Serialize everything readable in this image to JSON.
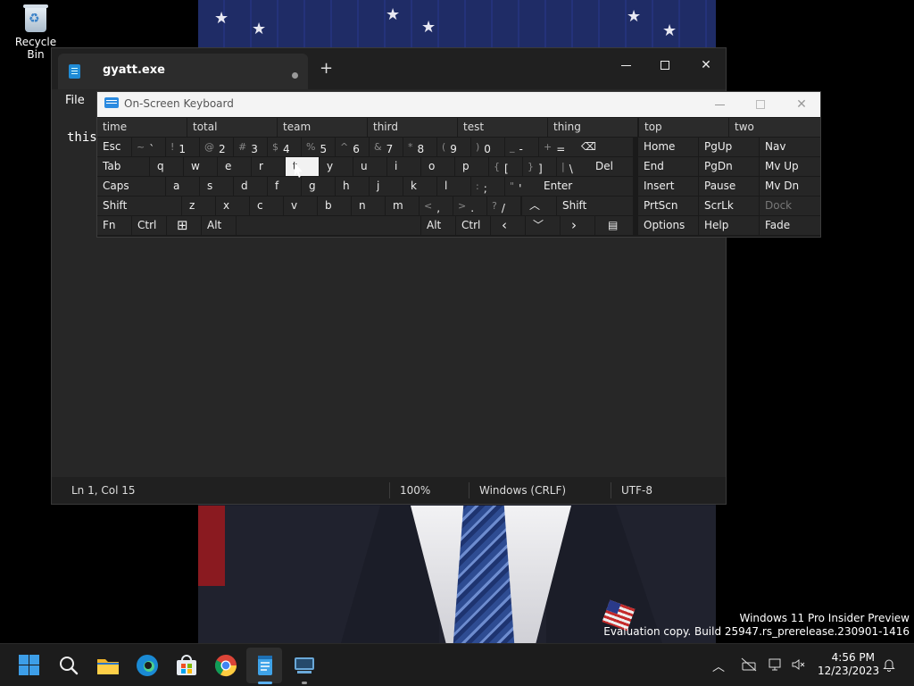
{
  "desktop": {
    "recycle_bin_label": "Recycle Bin",
    "watermark_line1": "Windows 11 Pro Insider Preview",
    "watermark_line2": "Evaluation copy. Build 25947.rs_prerelease.230901-1416"
  },
  "notepad": {
    "tab_title": "gyatt.exe",
    "new_tab": "+",
    "close_glyph": "✕",
    "menu_file": "File",
    "editor_text": "this",
    "status": {
      "position": "Ln 1, Col 15",
      "zoom": "100%",
      "line_ending": "Windows (CRLF)",
      "encoding": "UTF-8"
    }
  },
  "osk": {
    "title": "On-Screen Keyboard",
    "close_glyph": "✕",
    "suggestions": [
      "time",
      "total",
      "team",
      "third",
      "test",
      "thing",
      "top",
      "two"
    ],
    "row1": {
      "esc": "Esc",
      "symbols": [
        {
          "shift": "~",
          "base": "`"
        },
        {
          "shift": "!",
          "base": "1"
        },
        {
          "shift": "@",
          "base": "2"
        },
        {
          "shift": "#",
          "base": "3"
        },
        {
          "shift": "$",
          "base": "4"
        },
        {
          "shift": "%",
          "base": "5"
        },
        {
          "shift": "^",
          "base": "6"
        },
        {
          "shift": "&",
          "base": "7"
        },
        {
          "shift": "*",
          "base": "8"
        },
        {
          "shift": "(",
          "base": "9"
        },
        {
          "shift": ")",
          "base": "0"
        },
        {
          "shift": "_",
          "base": "-"
        },
        {
          "shift": "+",
          "base": "="
        }
      ],
      "backspace": "⌫"
    },
    "row2": {
      "tab": "Tab",
      "letters": [
        "q",
        "w",
        "e",
        "r",
        "t",
        "y",
        "u",
        "i",
        "o",
        "p"
      ],
      "symbols": [
        {
          "shift": "{",
          "base": "["
        },
        {
          "shift": "}",
          "base": "]"
        },
        {
          "shift": "|",
          "base": "\\"
        }
      ],
      "del": "Del"
    },
    "row3": {
      "caps": "Caps",
      "letters": [
        "a",
        "s",
        "d",
        "f",
        "g",
        "h",
        "j",
        "k",
        "l"
      ],
      "symbols": [
        {
          "shift": ":",
          "base": ";"
        },
        {
          "shift": "\"",
          "base": "'"
        }
      ],
      "enter": "Enter"
    },
    "row4": {
      "shift_left": "Shift",
      "letters": [
        "z",
        "x",
        "c",
        "v",
        "b",
        "n",
        "m"
      ],
      "symbols": [
        {
          "shift": "<",
          "base": ","
        },
        {
          "shift": ">",
          "base": "."
        },
        {
          "shift": "?",
          "base": "/"
        }
      ],
      "up": "︿",
      "shift_right": "Shift"
    },
    "row5": {
      "fn": "Fn",
      "ctrl_left": "Ctrl",
      "win": "⊞",
      "alt_left": "Alt",
      "alt_right": "Alt",
      "ctrl_right": "Ctrl",
      "left": "‹",
      "down": "﹀",
      "right": "›",
      "menu": "▤"
    },
    "nav_keys": [
      [
        "Home",
        "PgUp",
        "Nav"
      ],
      [
        "End",
        "PgDn",
        "Mv Up"
      ],
      [
        "Insert",
        "Pause",
        "Mv Dn"
      ],
      [
        "PrtScn",
        "ScrLk",
        "Dock"
      ],
      [
        "Options",
        "Help",
        "Fade"
      ]
    ]
  },
  "taskbar": {
    "clock_time": "4:56 PM",
    "clock_date": "12/23/2023",
    "tray_chevron": "︿"
  }
}
